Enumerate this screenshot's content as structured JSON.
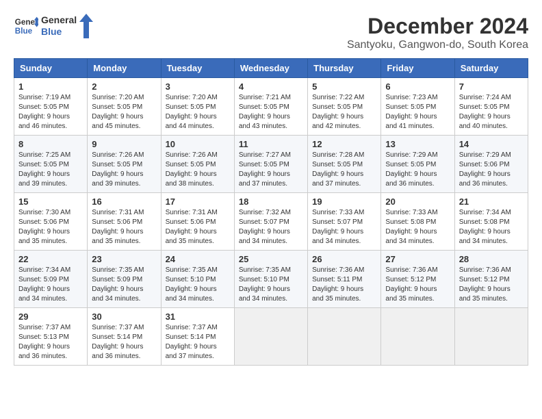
{
  "header": {
    "logo_line1": "General",
    "logo_line2": "Blue",
    "main_title": "December 2024",
    "subtitle": "Santyoku, Gangwon-do, South Korea"
  },
  "days_of_week": [
    "Sunday",
    "Monday",
    "Tuesday",
    "Wednesday",
    "Thursday",
    "Friday",
    "Saturday"
  ],
  "weeks": [
    [
      {
        "day": "1",
        "info": "Sunrise: 7:19 AM\nSunset: 5:05 PM\nDaylight: 9 hours and 46 minutes."
      },
      {
        "day": "2",
        "info": "Sunrise: 7:20 AM\nSunset: 5:05 PM\nDaylight: 9 hours and 45 minutes."
      },
      {
        "day": "3",
        "info": "Sunrise: 7:20 AM\nSunset: 5:05 PM\nDaylight: 9 hours and 44 minutes."
      },
      {
        "day": "4",
        "info": "Sunrise: 7:21 AM\nSunset: 5:05 PM\nDaylight: 9 hours and 43 minutes."
      },
      {
        "day": "5",
        "info": "Sunrise: 7:22 AM\nSunset: 5:05 PM\nDaylight: 9 hours and 42 minutes."
      },
      {
        "day": "6",
        "info": "Sunrise: 7:23 AM\nSunset: 5:05 PM\nDaylight: 9 hours and 41 minutes."
      },
      {
        "day": "7",
        "info": "Sunrise: 7:24 AM\nSunset: 5:05 PM\nDaylight: 9 hours and 40 minutes."
      }
    ],
    [
      {
        "day": "8",
        "info": "Sunrise: 7:25 AM\nSunset: 5:05 PM\nDaylight: 9 hours and 39 minutes."
      },
      {
        "day": "9",
        "info": "Sunrise: 7:26 AM\nSunset: 5:05 PM\nDaylight: 9 hours and 39 minutes."
      },
      {
        "day": "10",
        "info": "Sunrise: 7:26 AM\nSunset: 5:05 PM\nDaylight: 9 hours and 38 minutes."
      },
      {
        "day": "11",
        "info": "Sunrise: 7:27 AM\nSunset: 5:05 PM\nDaylight: 9 hours and 37 minutes."
      },
      {
        "day": "12",
        "info": "Sunrise: 7:28 AM\nSunset: 5:05 PM\nDaylight: 9 hours and 37 minutes."
      },
      {
        "day": "13",
        "info": "Sunrise: 7:29 AM\nSunset: 5:05 PM\nDaylight: 9 hours and 36 minutes."
      },
      {
        "day": "14",
        "info": "Sunrise: 7:29 AM\nSunset: 5:06 PM\nDaylight: 9 hours and 36 minutes."
      }
    ],
    [
      {
        "day": "15",
        "info": "Sunrise: 7:30 AM\nSunset: 5:06 PM\nDaylight: 9 hours and 35 minutes."
      },
      {
        "day": "16",
        "info": "Sunrise: 7:31 AM\nSunset: 5:06 PM\nDaylight: 9 hours and 35 minutes."
      },
      {
        "day": "17",
        "info": "Sunrise: 7:31 AM\nSunset: 5:06 PM\nDaylight: 9 hours and 35 minutes."
      },
      {
        "day": "18",
        "info": "Sunrise: 7:32 AM\nSunset: 5:07 PM\nDaylight: 9 hours and 34 minutes."
      },
      {
        "day": "19",
        "info": "Sunrise: 7:33 AM\nSunset: 5:07 PM\nDaylight: 9 hours and 34 minutes."
      },
      {
        "day": "20",
        "info": "Sunrise: 7:33 AM\nSunset: 5:08 PM\nDaylight: 9 hours and 34 minutes."
      },
      {
        "day": "21",
        "info": "Sunrise: 7:34 AM\nSunset: 5:08 PM\nDaylight: 9 hours and 34 minutes."
      }
    ],
    [
      {
        "day": "22",
        "info": "Sunrise: 7:34 AM\nSunset: 5:09 PM\nDaylight: 9 hours and 34 minutes."
      },
      {
        "day": "23",
        "info": "Sunrise: 7:35 AM\nSunset: 5:09 PM\nDaylight: 9 hours and 34 minutes."
      },
      {
        "day": "24",
        "info": "Sunrise: 7:35 AM\nSunset: 5:10 PM\nDaylight: 9 hours and 34 minutes."
      },
      {
        "day": "25",
        "info": "Sunrise: 7:35 AM\nSunset: 5:10 PM\nDaylight: 9 hours and 34 minutes."
      },
      {
        "day": "26",
        "info": "Sunrise: 7:36 AM\nSunset: 5:11 PM\nDaylight: 9 hours and 35 minutes."
      },
      {
        "day": "27",
        "info": "Sunrise: 7:36 AM\nSunset: 5:12 PM\nDaylight: 9 hours and 35 minutes."
      },
      {
        "day": "28",
        "info": "Sunrise: 7:36 AM\nSunset: 5:12 PM\nDaylight: 9 hours and 35 minutes."
      }
    ],
    [
      {
        "day": "29",
        "info": "Sunrise: 7:37 AM\nSunset: 5:13 PM\nDaylight: 9 hours and 36 minutes."
      },
      {
        "day": "30",
        "info": "Sunrise: 7:37 AM\nSunset: 5:14 PM\nDaylight: 9 hours and 36 minutes."
      },
      {
        "day": "31",
        "info": "Sunrise: 7:37 AM\nSunset: 5:14 PM\nDaylight: 9 hours and 37 minutes."
      },
      null,
      null,
      null,
      null
    ]
  ]
}
